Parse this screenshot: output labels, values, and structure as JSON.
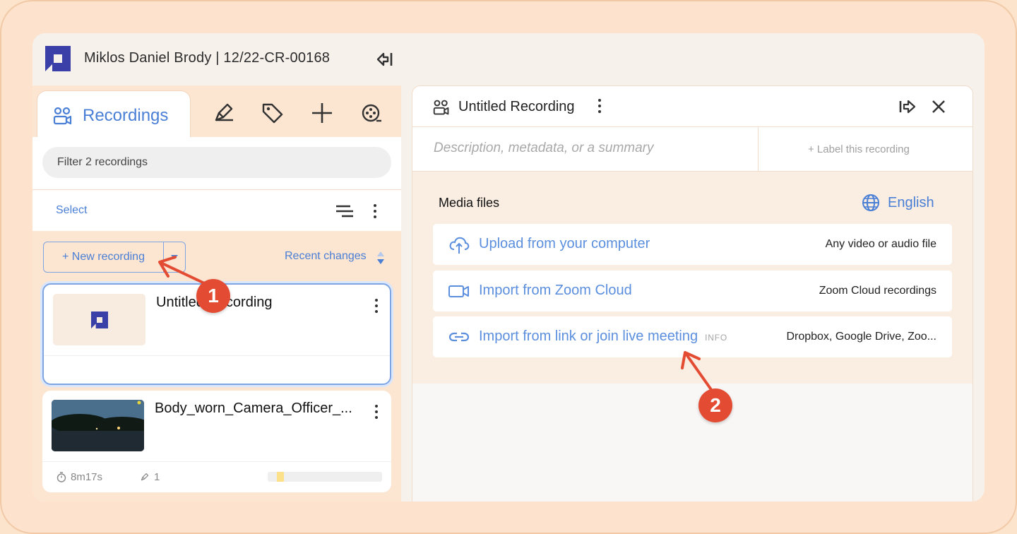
{
  "header": {
    "case_title": "Miklos Daniel Brody | 12/22-CR-00168"
  },
  "left_panel": {
    "active_tab": "Recordings",
    "filter_placeholder": "Filter 2 recordings",
    "select_label": "Select",
    "new_recording_label": "+ New recording",
    "sort_label": "Recent changes",
    "recordings": [
      {
        "title": "Untitled Recording",
        "selected": true
      },
      {
        "title": "Body_worn_Camera_Officer_...",
        "duration": "8m17s",
        "markers": "1"
      }
    ]
  },
  "right_panel": {
    "title": "Untitled Recording",
    "description_placeholder": "Description, metadata, or a summary",
    "label_link": "+ Label this recording",
    "media_title": "Media files",
    "language": "English",
    "options": [
      {
        "label": "Upload from your computer",
        "info": "",
        "hint": "Any video or audio file",
        "icon": "cloud-upload-icon"
      },
      {
        "label": "Import from Zoom Cloud",
        "info": "",
        "hint": "Zoom Cloud recordings",
        "icon": "video-camera-icon"
      },
      {
        "label": "Import from link or join live meeting",
        "info": "INFO",
        "hint": "Dropbox, Google Drive, Zoo...",
        "icon": "link-icon"
      }
    ]
  },
  "annotations": {
    "step1": "1",
    "step2": "2"
  },
  "colors": {
    "accent": "#4a7fd6",
    "badge": "#e34b33",
    "frame": "#fde3cd"
  }
}
